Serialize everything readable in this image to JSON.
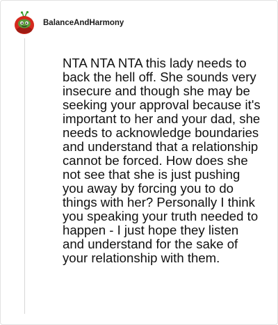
{
  "comment": {
    "author": "BalanceAndHarmony",
    "avatar_icon": "red-creature-avatar-icon",
    "body": "NTA NTA NTA this lady needs to back the hell off. She sounds very insecure and though she may be seeking your approval because it's important to her and your dad, she needs to acknowledge boundaries and understand that a relationship cannot be forced. How does she not see that she is just pushing you away by forcing you to do things with her? Personally I think you speaking your truth needed to happen - I just hope they listen and understand for the sake of your relationship with them."
  },
  "colors": {
    "avatar_red": "#d52a1e",
    "avatar_green": "#3a9c2e",
    "thread_line": "#d7d7d7",
    "text": "#111111"
  }
}
